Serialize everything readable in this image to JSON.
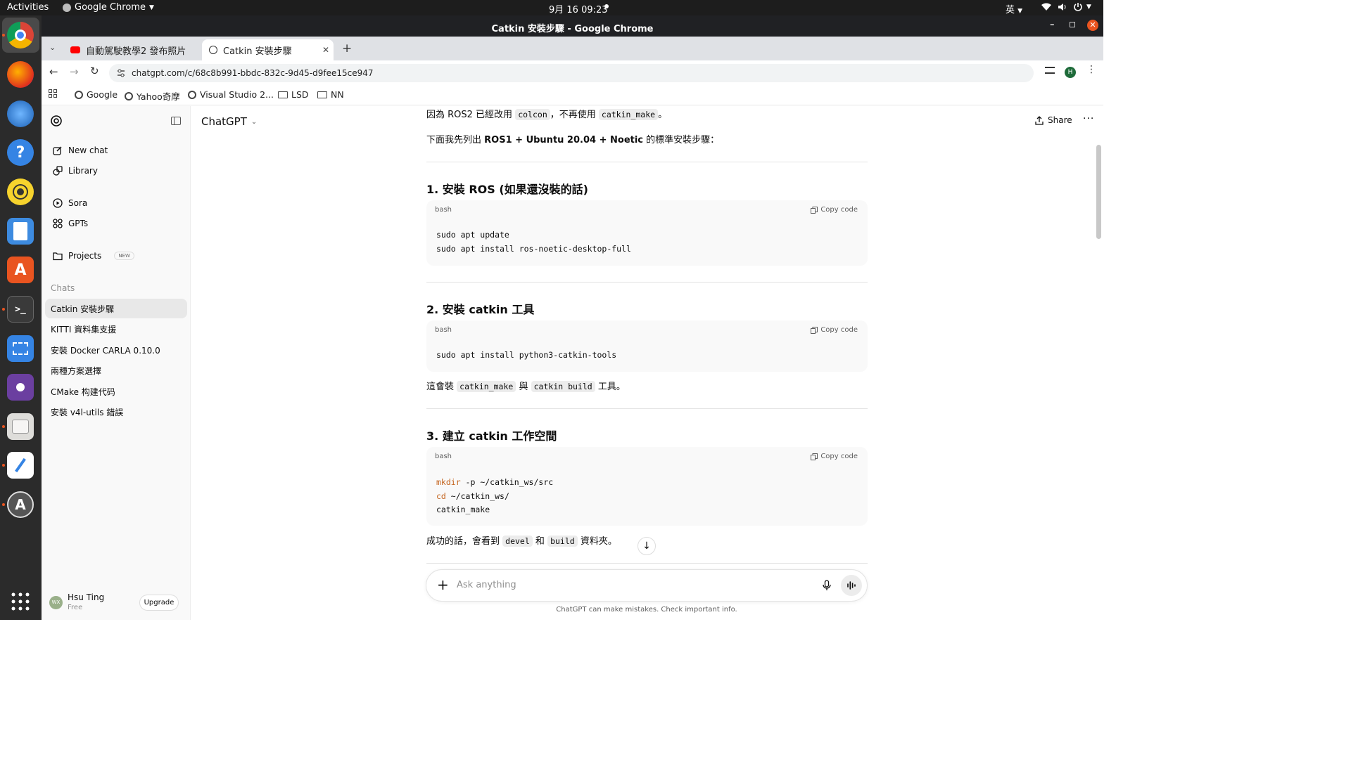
{
  "system": {
    "activities": "Activities",
    "app_name": "Google Chrome",
    "clock": "9月 16  09:23",
    "input_method": "英"
  },
  "window": {
    "title": "Catkin 安裝步驟 - Google Chrome"
  },
  "tabs": [
    {
      "label": "自動駕駛教學2 發布照片",
      "active": false
    },
    {
      "label": "Catkin 安裝步驟",
      "active": true
    }
  ],
  "address_bar": {
    "url": "chatgpt.com/c/68c8b991-bbdc-832c-9d45-d9fee15ce947",
    "profile_initial": "H"
  },
  "bookmarks": [
    "Google",
    "Yahoo奇摩",
    "Visual Studio 2...",
    "LSD",
    "NN"
  ],
  "sidebar": {
    "nav": [
      {
        "label": "New chat",
        "icon": "pencil-square-icon"
      },
      {
        "label": "Library",
        "icon": "library-icon"
      },
      {
        "label": "Sora",
        "icon": "play-circle-icon"
      },
      {
        "label": "GPTs",
        "icon": "grid-icon"
      },
      {
        "label": "Projects",
        "icon": "folder-icon"
      }
    ],
    "projects_badge": "NEW",
    "chats_heading": "Chats",
    "chats": [
      {
        "label": "Catkin 安裝步驟",
        "active": true
      },
      {
        "label": "KITTI 資料集支援",
        "active": false
      },
      {
        "label": "安裝 Docker CARLA 0.10.0",
        "active": false
      },
      {
        "label": "兩種方案選擇",
        "active": false
      },
      {
        "label": "CMake 构建代码",
        "active": false
      },
      {
        "label": "安裝 v4l-utils 錯誤",
        "active": false
      }
    ],
    "user": {
      "avatar": "WX",
      "name": "Hsu Ting",
      "plan": "Free",
      "upgrade": "Upgrade"
    }
  },
  "header": {
    "model": "ChatGPT",
    "share": "Share"
  },
  "message": {
    "line1_pre": "因為 ROS2 已經改用",
    "line1_code1": "colcon",
    "line1_mid": "，不再使用",
    "line1_code2": "catkin_make",
    "line1_post": "。",
    "line2_pre": "下面我先列出",
    "line2_bold": "ROS1 + Ubuntu 20.04 + Noetic",
    "line2_post": "的標準安裝步驟：",
    "sections": [
      {
        "heading": "1. 安裝 ROS (如果還沒裝的話)",
        "lang": "bash",
        "copy": "Copy code",
        "lines": [
          "sudo apt update",
          "sudo apt install ros-noetic-desktop-full"
        ]
      },
      {
        "heading": "2. 安裝 catkin 工具",
        "lang": "bash",
        "copy": "Copy code",
        "lines": [
          "sudo apt install python3-catkin-tools"
        ],
        "after_pre": "這會裝",
        "after_code1": "catkin_make",
        "after_mid": "與",
        "after_code2": "catkin build",
        "after_post": "工具。"
      },
      {
        "heading": "3. 建立 catkin 工作空間",
        "lang": "bash",
        "copy": "Copy code",
        "lines": [
          {
            "kw": "mkdir",
            "rest": " -p ~/catkin_ws/src"
          },
          {
            "kw": "cd",
            "rest": " ~/catkin_ws/"
          },
          {
            "kw": "",
            "rest": "catkin_make"
          }
        ],
        "after_pre": "成功的話，會看到",
        "after_code1": "devel",
        "after_mid": "和",
        "after_code2": "build",
        "after_post": "資料夾。"
      }
    ]
  },
  "composer": {
    "placeholder": "Ask anything",
    "disclaimer": "ChatGPT can make mistakes. Check important info."
  },
  "colors": {
    "sidebar_bg": "#f9f9f9",
    "active_chat_bg": "#e8e8e8",
    "code_bg": "#f9f9f9",
    "keyword": "#c4641e",
    "chrome_dark": "#202124",
    "dock_bg": "#2b2b2b"
  }
}
